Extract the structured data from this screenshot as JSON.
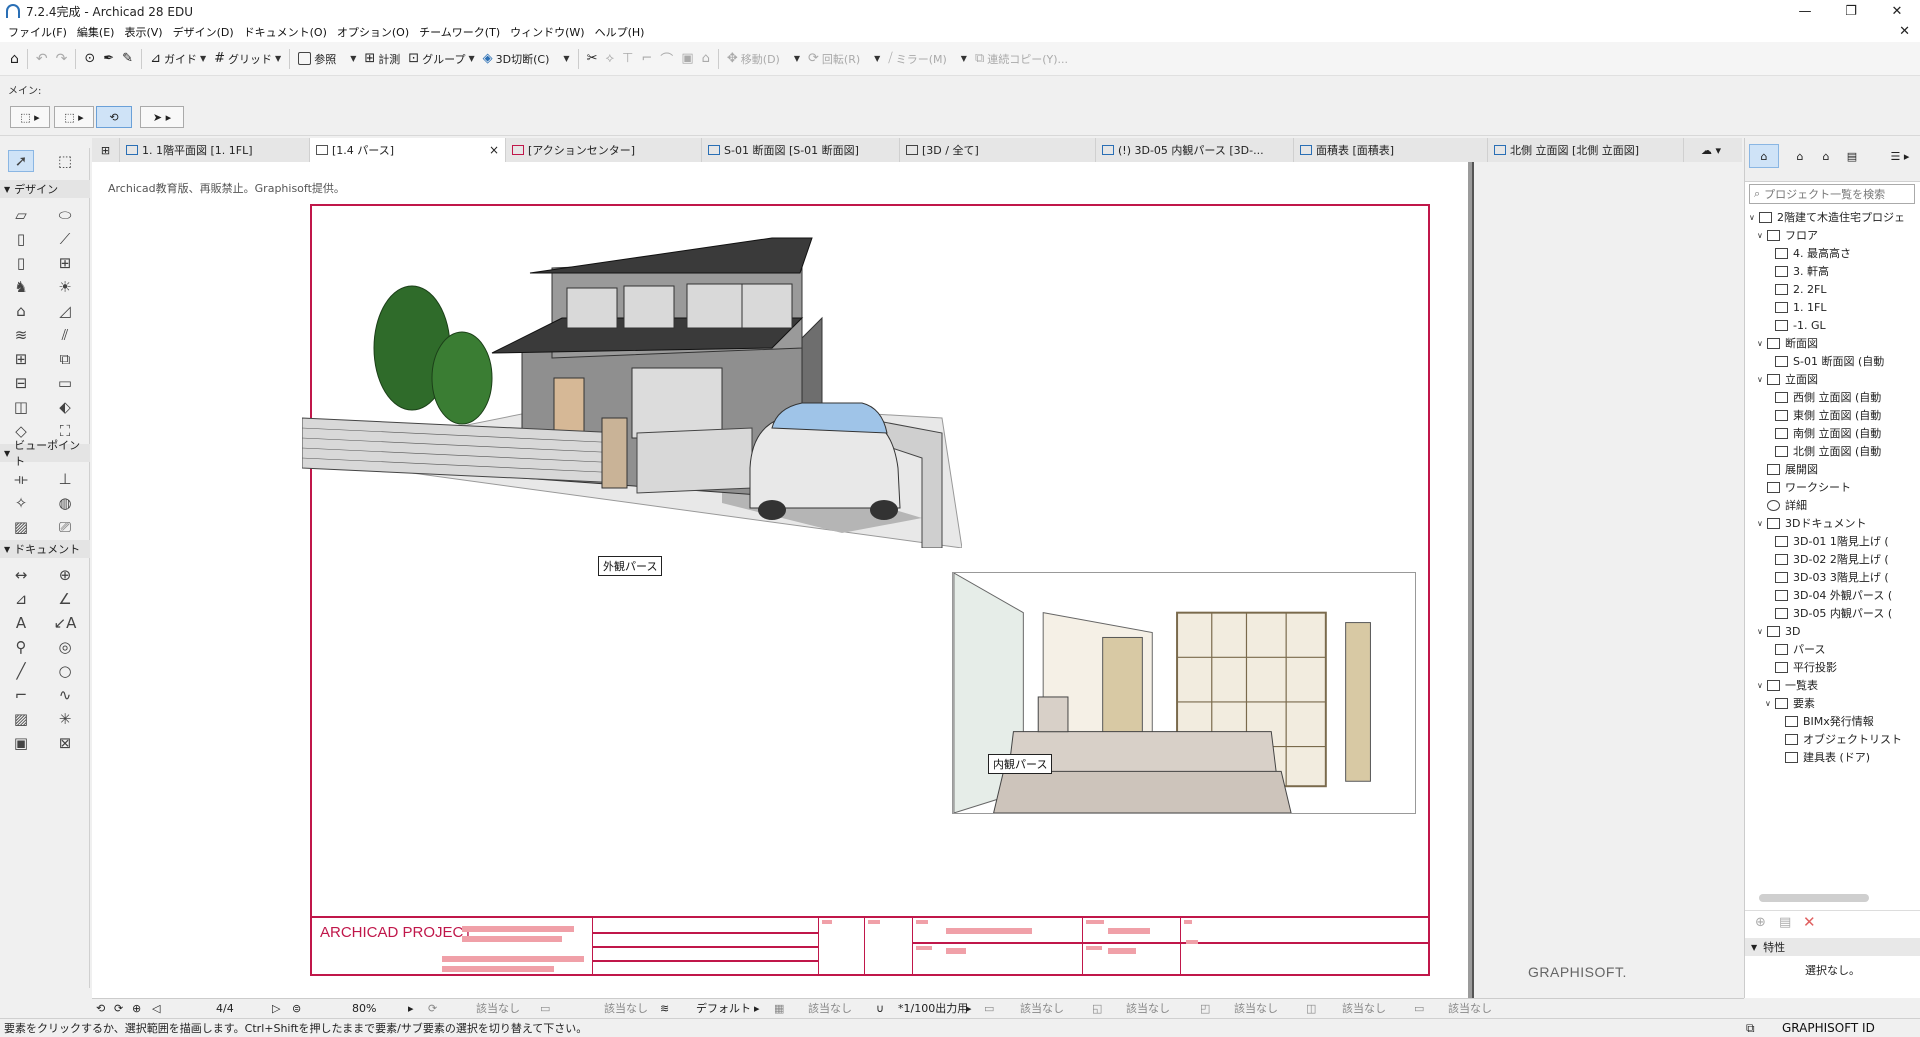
{
  "window": {
    "title": "7.2.4完成 - Archicad 28 EDU",
    "minimize": "—",
    "maximize": "❐",
    "close": "✕"
  },
  "menu": {
    "items": [
      "ファイル(F)",
      "編集(E)",
      "表示(V)",
      "デザイン(D)",
      "ドキュメント(O)",
      "オプション(O)",
      "チームワーク(T)",
      "ウィンドウ(W)",
      "ヘルプ(H)"
    ],
    "doc_close": "✕"
  },
  "toolbar": {
    "guide": "ガイド",
    "grid": "グリッド",
    "reference": "参照",
    "measure": "計測",
    "group": "グループ",
    "cut3d": "3D切断(C)",
    "move": "移動(D)",
    "rotate": "回転(R)",
    "mirror": "ミラー(M)",
    "multiply": "連続コピー(Y)..."
  },
  "infobox": {
    "main_label": "メイン:"
  },
  "tabs": [
    {
      "label": "1. 1階平面図 [1. 1FL]",
      "active": false
    },
    {
      "label": "[1.4 パース]",
      "active": true,
      "close": "×"
    },
    {
      "label": "[アクションセンター]",
      "active": false
    },
    {
      "label": "S-01 断面図 [S-01 断面図]",
      "active": false
    },
    {
      "label": "[3D / 全て]",
      "active": false
    },
    {
      "label": "(!) 3D-05 内観パース [3D-...",
      "active": false
    },
    {
      "label": "面積表 [面積表]",
      "active": false
    },
    {
      "label": "北側 立面図 [北側 立面図]",
      "active": false
    }
  ],
  "toolbox": {
    "design": "デザイン",
    "viewpoint": "ビューポイント",
    "document": "ドキュメント"
  },
  "canvas": {
    "edu_note": "Archicad教育版、再販禁止。Graphisoft提供。",
    "exterior_label": "外観パース",
    "interior_label": "内観パース",
    "project_name": "ARCHICAD PROJECT",
    "logo": "GRAPHISOFT."
  },
  "navigator": {
    "search_placeholder": "プロジェクト一覧を検索",
    "tree": [
      {
        "label": "2階建て木造住宅プロジェ",
        "level": 0,
        "expanded": true
      },
      {
        "label": "フロア",
        "level": 1,
        "expanded": true
      },
      {
        "label": "4. 最高高さ",
        "level": 2
      },
      {
        "label": "3. 軒高",
        "level": 2
      },
      {
        "label": "2. 2FL",
        "level": 2
      },
      {
        "label": "1. 1FL",
        "level": 2
      },
      {
        "label": "-1. GL",
        "level": 2
      },
      {
        "label": "断面図",
        "level": 1,
        "expanded": true
      },
      {
        "label": "S-01 断面図 (自動",
        "level": 2
      },
      {
        "label": "立面図",
        "level": 1,
        "expanded": true
      },
      {
        "label": "西側 立面図 (自動",
        "level": 2
      },
      {
        "label": "東側 立面図 (自動",
        "level": 2
      },
      {
        "label": "南側 立面図 (自動",
        "level": 2
      },
      {
        "label": "北側 立面図 (自動",
        "level": 2
      },
      {
        "label": "展開図",
        "level": 1
      },
      {
        "label": "ワークシート",
        "level": 1
      },
      {
        "label": "詳細",
        "level": 1
      },
      {
        "label": "3Dドキュメント",
        "level": 1,
        "expanded": true
      },
      {
        "label": "3D-01 1階見上げ (",
        "level": 2
      },
      {
        "label": "3D-02 2階見上げ (",
        "level": 2
      },
      {
        "label": "3D-03 3階見上げ (",
        "level": 2
      },
      {
        "label": "3D-04 外観パース (",
        "level": 2
      },
      {
        "label": "3D-05 内観パース (",
        "level": 2
      },
      {
        "label": "3D",
        "level": 1,
        "expanded": true
      },
      {
        "label": "パース",
        "level": 2
      },
      {
        "label": "平行投影",
        "level": 2
      },
      {
        "label": "一覧表",
        "level": 1,
        "expanded": true
      },
      {
        "label": "要素",
        "level": 2,
        "expanded": true
      },
      {
        "label": "BIMx発行情報",
        "level": 3
      },
      {
        "label": "オブジェクトリスト",
        "level": 3
      },
      {
        "label": "建具表 (ドア)",
        "level": 3
      }
    ],
    "props_head": "特性",
    "props_value": "選択なし。"
  },
  "quickbar": {
    "page": "4/4",
    "zoom": "80%",
    "none1": "該当なし",
    "none2": "該当なし",
    "layer": "デフォルト",
    "none3": "該当なし",
    "scale": "*1/100出力用",
    "none4": "該当なし",
    "none5": "該当なし",
    "none6": "該当なし",
    "none7": "該当なし",
    "none8": "該当なし"
  },
  "status": {
    "message": "要素をクリックするか、選択範囲を描画します。Ctrl+Shiftを押したままで要素/サブ要素の選択を切り替えて下さい。",
    "graphisoft_id": "GRAPHISOFT ID"
  },
  "colors": {
    "accent": "#c0174a",
    "selection": "#cfe3f7"
  }
}
